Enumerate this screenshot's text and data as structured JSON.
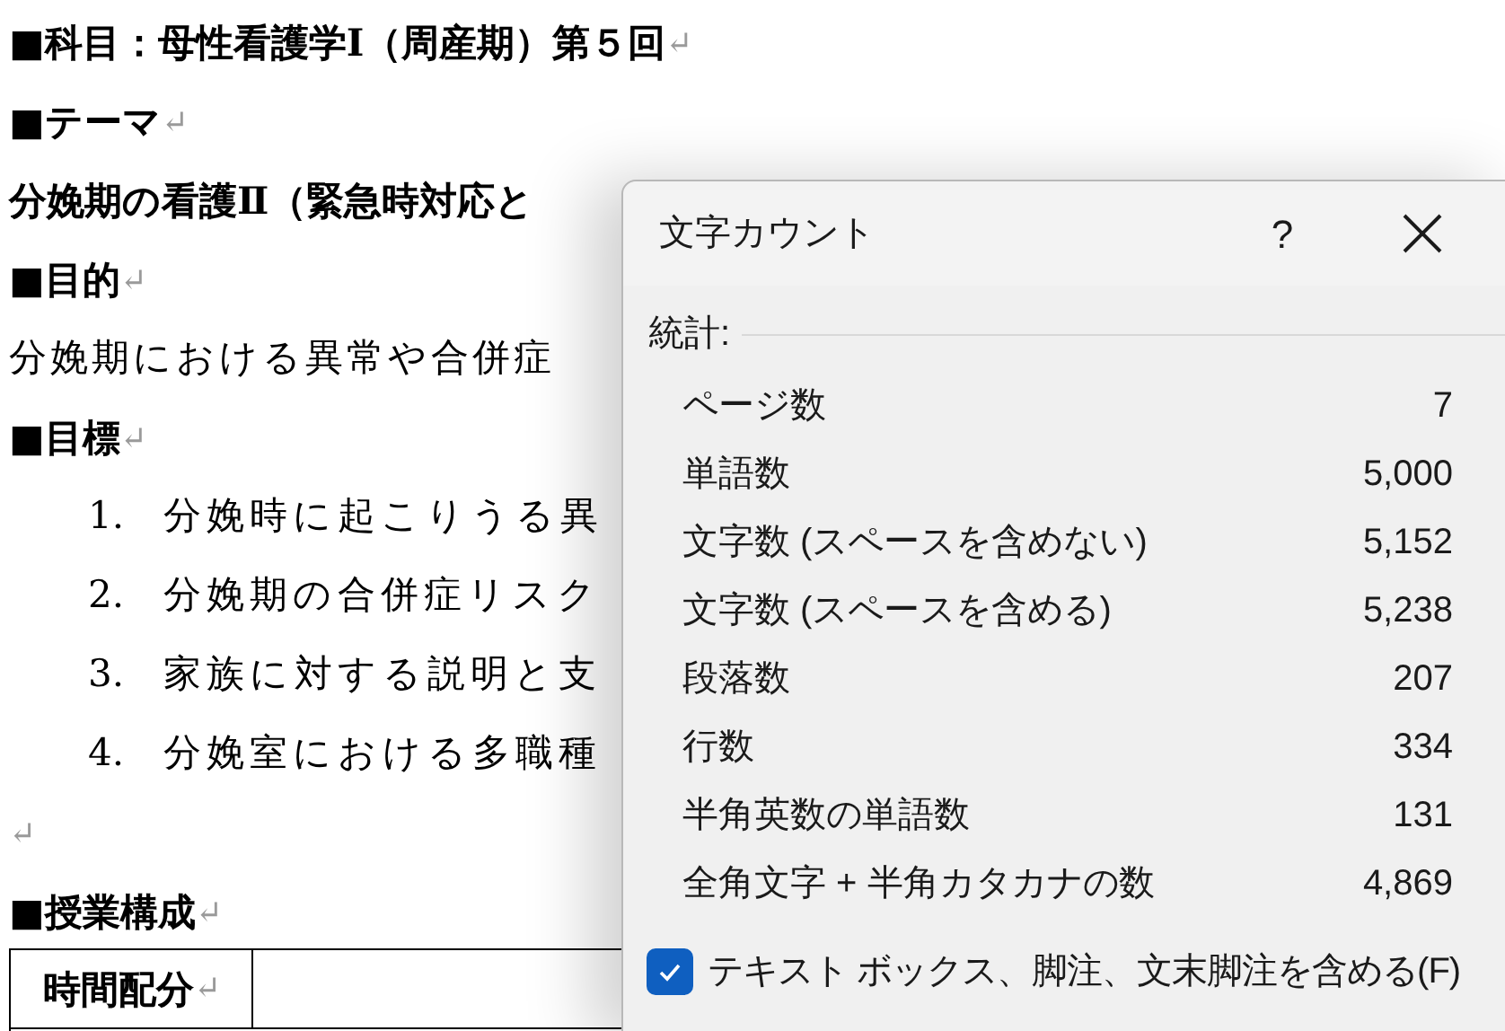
{
  "document": {
    "blocks": [
      {
        "kind": "heading",
        "text": "■科目：母性看護学Ⅰ（周産期）第５回",
        "mark": "↵"
      },
      {
        "kind": "heading",
        "text": "■テーマ",
        "mark": "↵"
      },
      {
        "kind": "strong",
        "text": "分娩期の看護Ⅱ（緊急時対応と"
      },
      {
        "kind": "heading",
        "text": "■目的",
        "mark": "↵"
      },
      {
        "kind": "text",
        "text": "分娩期における異常や合併症"
      },
      {
        "kind": "heading",
        "text": "■目標",
        "mark": "↵"
      },
      {
        "kind": "item",
        "number": "1.",
        "text": "分娩時に起こりうる異"
      },
      {
        "kind": "item",
        "number": "2.",
        "text": "分娩期の合併症リスク"
      },
      {
        "kind": "item",
        "number": "3.",
        "text": "家族に対する説明と支"
      },
      {
        "kind": "item",
        "number": "4.",
        "text": "分娩室における多職種"
      },
      {
        "kind": "empty",
        "mark": "↵"
      },
      {
        "kind": "heading",
        "text": "■授業構成",
        "mark": "↵"
      }
    ],
    "table": {
      "cell": "時間配分",
      "mark": "↵"
    }
  },
  "dialog": {
    "title": "文字カウント",
    "help": "?",
    "section_label": "統計:",
    "stats": [
      {
        "label": "ページ数",
        "value": "7"
      },
      {
        "label": "単語数",
        "value": "5,000"
      },
      {
        "label": "文字数 (スペースを含めない)",
        "value": "5,152"
      },
      {
        "label": "文字数 (スペースを含める)",
        "value": "5,238"
      },
      {
        "label": "段落数",
        "value": "207"
      },
      {
        "label": "行数",
        "value": "334"
      },
      {
        "label": "半角英数の単語数",
        "value": "131"
      },
      {
        "label": "全角文字 + 半角カタカナの数",
        "value": "4,869"
      }
    ],
    "checkbox": {
      "label": "テキスト ボックス、脚注、文末脚注を含める(F)",
      "checked": true
    }
  }
}
